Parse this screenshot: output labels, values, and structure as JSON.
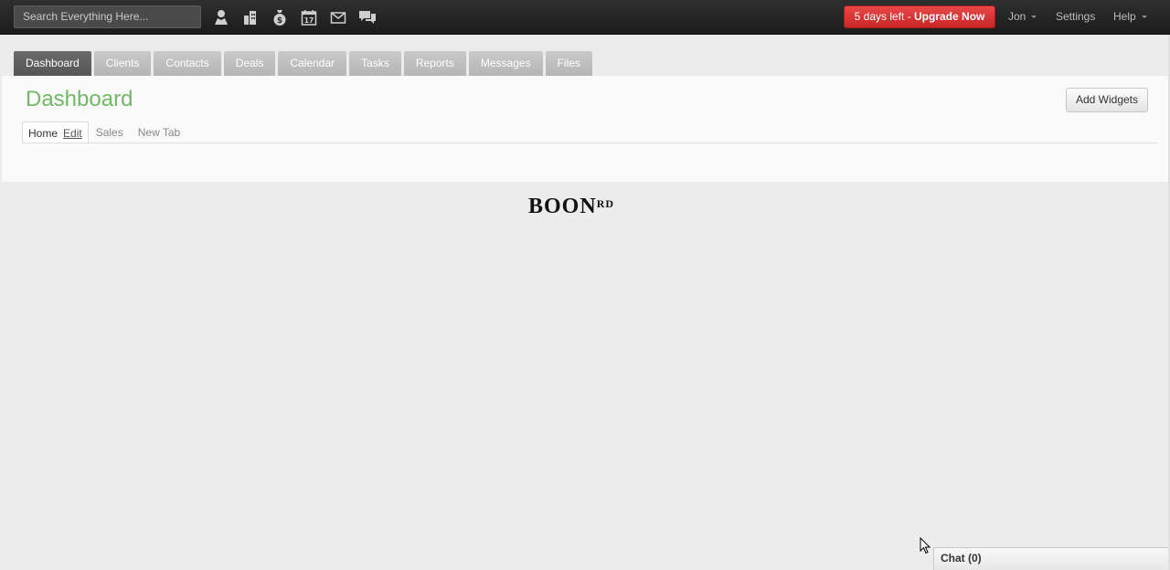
{
  "topbar": {
    "search_placeholder": "Search Everything Here...",
    "quick_icons": [
      "person-icon",
      "building-icon",
      "money-bag-icon",
      "calendar-icon",
      "envelope-icon",
      "chat-bubbles-icon"
    ],
    "calendar_day": "17",
    "upgrade_prefix": "5 days left - ",
    "upgrade_action": "Upgrade Now",
    "user_name": "Jon",
    "settings_label": "Settings",
    "help_label": "Help"
  },
  "main_tabs": [
    "Dashboard",
    "Clients",
    "Contacts",
    "Deals",
    "Calendar",
    "Tasks",
    "Reports",
    "Messages",
    "Files"
  ],
  "active_tab": "Dashboard",
  "page": {
    "title": "Dashboard",
    "add_widgets_label": "Add Widgets"
  },
  "subtabs": {
    "home": "Home",
    "edit": "Edit",
    "sales": "Sales",
    "new_tab": "New Tab"
  },
  "logo": {
    "main": "BOON",
    "sup": "RD"
  },
  "chat": {
    "label": "Chat (0)"
  },
  "colors": {
    "topbar": "#262626",
    "upgrade": "#d93434",
    "title_green": "#72b866",
    "tab_active": "#5f5f5f",
    "tab_inactive": "#bdbdbd"
  }
}
